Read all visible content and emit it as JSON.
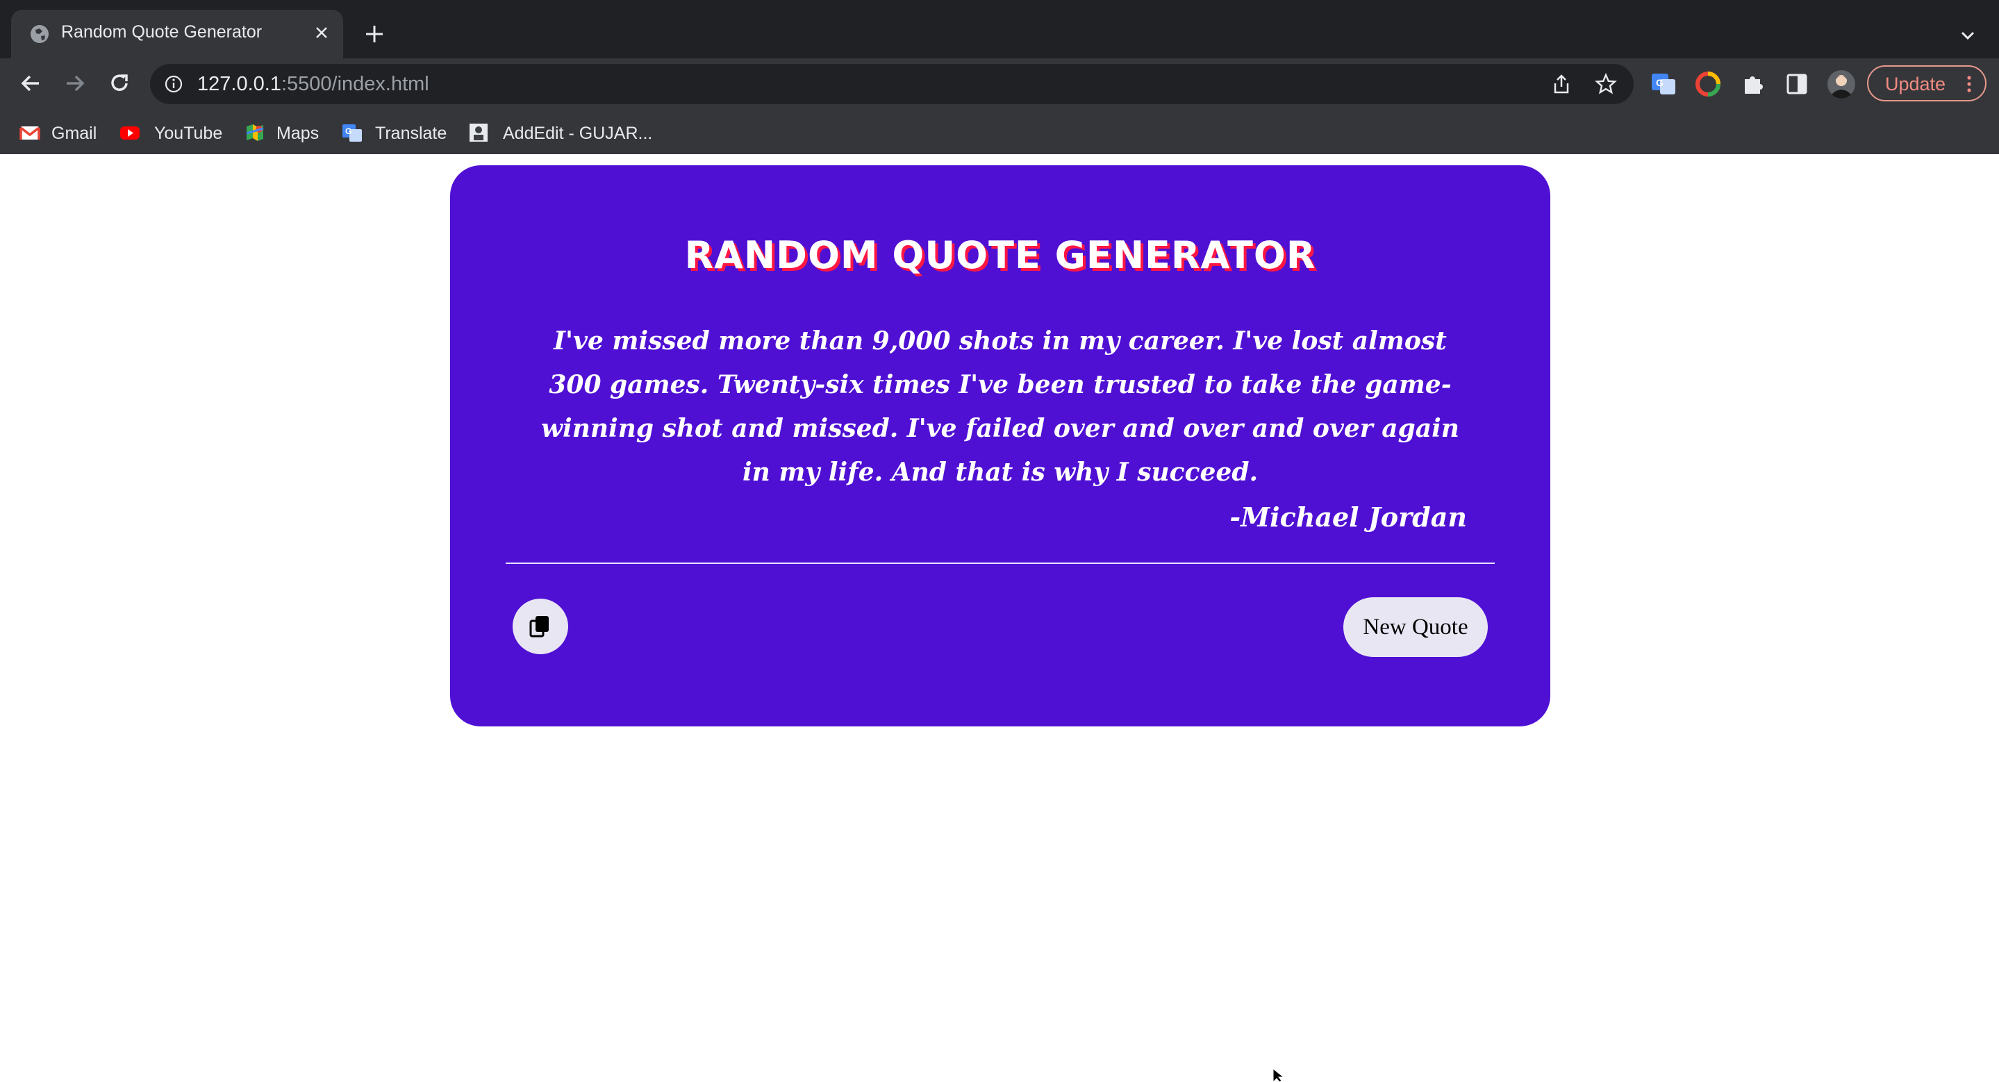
{
  "browser": {
    "tab": {
      "title": "Random Quote Generator"
    },
    "address": {
      "host": "127.0.0.1",
      "rest": ":5500/index.html"
    },
    "update_label": "Update",
    "bookmarks": [
      {
        "label": "Gmail",
        "icon": "gmail-icon"
      },
      {
        "label": "YouTube",
        "icon": "youtube-icon"
      },
      {
        "label": "Maps",
        "icon": "maps-icon"
      },
      {
        "label": "Translate",
        "icon": "translate-icon"
      },
      {
        "label": "AddEdit - GUJAR...",
        "icon": "addedit-icon"
      }
    ]
  },
  "page": {
    "title": "RANDOM QUOTE GENERATOR",
    "quote": "I've missed more than 9,000 shots in my career. I've lost almost 300 games. Twenty-six times I've been trusted to take the game-winning shot and missed. I've failed over and over and over again in my life. And that is why I succeed.",
    "author": "-Michael Jordan",
    "new_quote_label": "New Quote"
  },
  "colors": {
    "card": "#4f10d3",
    "title_shadow": "#ff1744",
    "button_bg": "#e9e6f4"
  }
}
